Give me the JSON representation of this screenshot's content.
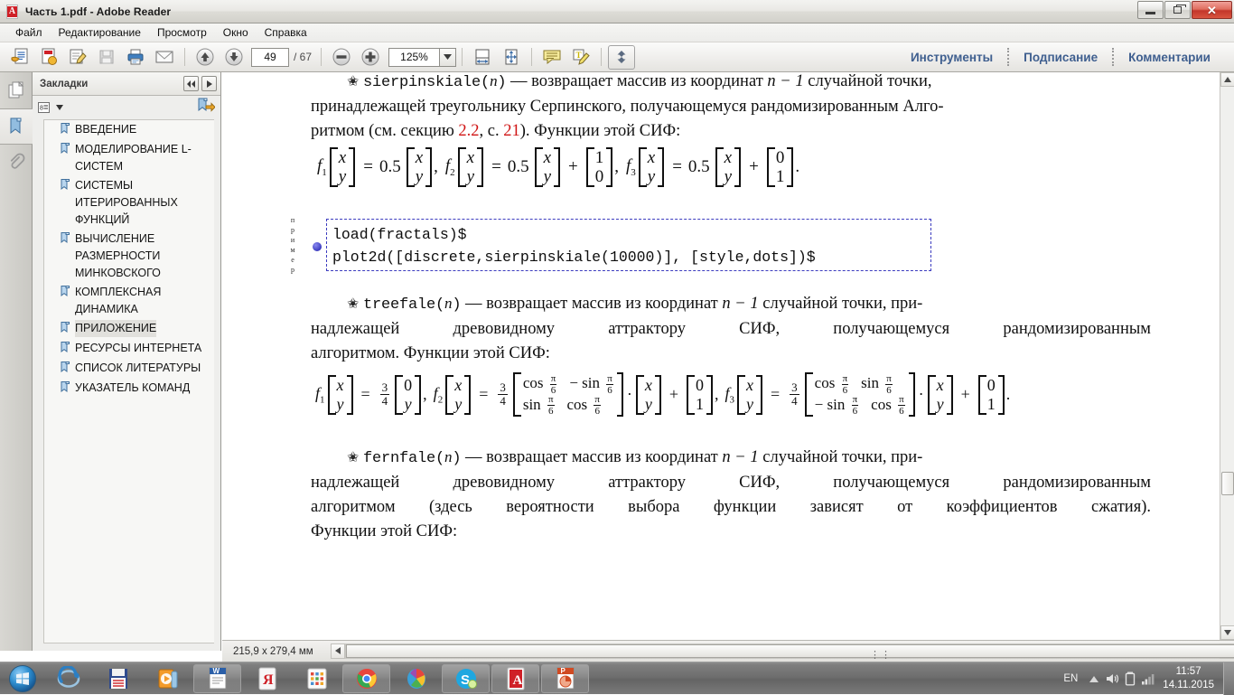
{
  "window": {
    "title": "Часть 1.pdf - Adobe Reader",
    "app_icon": "pdf-icon",
    "controls": {
      "minimize": "minimize-button",
      "restore": "restore-button",
      "close": "close-button"
    }
  },
  "menubar": {
    "items": [
      "Файл",
      "Редактирование",
      "Просмотр",
      "Окно",
      "Справка"
    ]
  },
  "toolbar": {
    "buttons": [
      {
        "name": "open-file-icon"
      },
      {
        "name": "create-pdf-icon"
      },
      {
        "name": "edit-pdf-icon"
      },
      {
        "name": "save-icon"
      },
      {
        "name": "print-icon"
      },
      {
        "name": "email-icon"
      }
    ],
    "nav": {
      "prev_page": "up-arrow-icon",
      "next_page": "down-arrow-icon"
    },
    "page_current": "49",
    "page_total": "/ 67",
    "zoom_out": "zoom-out-icon",
    "zoom_in": "zoom-in-icon",
    "zoom_value": "125%",
    "zoom_dropdown": "chevron-down-icon",
    "view_buttons": [
      {
        "name": "fit-width-icon"
      },
      {
        "name": "fit-page-icon"
      },
      {
        "name": "add-sticky-note-icon"
      },
      {
        "name": "highlight-text-icon"
      },
      {
        "name": "read-mode-icon"
      }
    ],
    "right_links": [
      "Инструменты",
      "Подписание",
      "Комментарии"
    ]
  },
  "rail": {
    "items": [
      {
        "name": "page-thumbnails-icon",
        "active": false
      },
      {
        "name": "bookmarks-icon",
        "active": true
      },
      {
        "name": "attachments-icon",
        "active": false
      }
    ]
  },
  "panel": {
    "title": "Закладки",
    "nav_prev": "double-left-chevron-icon",
    "nav_next": "right-chevron-icon",
    "options_menu": "bookmark-options-icon",
    "new_bookmark": "new-bookmark-icon",
    "bookmarks": [
      {
        "label": "ВВЕДЕНИЕ",
        "selected": false
      },
      {
        "label": "МОДЕЛИРОВАНИЕ L-СИСТЕМ",
        "selected": false
      },
      {
        "label": "СИСТЕМЫ ИТЕРИРОВАННЫХ ФУНКЦИЙ",
        "selected": false
      },
      {
        "label": "ВЫЧИСЛЕНИЕ РАЗМЕРНОСТИ МИНКОВСКОГО",
        "selected": false
      },
      {
        "label": "КОМПЛЕКСНАЯ ДИНАМИКА",
        "selected": false
      },
      {
        "label": "ПРИЛОЖЕНИЕ",
        "selected": true
      },
      {
        "label": "РЕСУРСЫ ИНТЕРНЕТА",
        "selected": false
      },
      {
        "label": "СПИСОК ЛИТЕРАТУРЫ",
        "selected": false
      },
      {
        "label": "УКАЗАТЕЛЬ КОМАНД",
        "selected": false
      }
    ]
  },
  "document": {
    "entry1": {
      "func": "sierpinskiale(",
      "func_arg": "n",
      "func_close": ")",
      "line1_rest": " — возвращает массив из координат ",
      "n_minus_1": "n − 1",
      "line1_tail": " случайной точки,",
      "line2": "принадлежащей треугольнику Серпинского, получающемуся рандомизированным Алго-",
      "line3_a": "ритмом (см. секцию ",
      "line3_ref1": "2.2",
      "line3_b": ", с. ",
      "line3_ref2": "21",
      "line3_c": "). Функции этой СИФ:"
    },
    "formula1": {
      "scalar": "0.5",
      "f1": "f",
      "f1sub": "1",
      "f2": "f",
      "f2sub": "2",
      "f3": "f",
      "f3sub": "3",
      "vx": "x",
      "vy": "y",
      "t2_top": "1",
      "t2_bot": "0",
      "t3_top": "0",
      "t3_bot": "1",
      "eq": "=",
      "plus": "+",
      "comma": ",",
      "period": "."
    },
    "code": {
      "side_label": "пример",
      "lines": [
        "load(fractals)$",
        "plot2d([discrete,sierpinskiale(10000)], [style,dots])$"
      ]
    },
    "entry2": {
      "func": "treefale(",
      "func_arg": "n",
      "func_close": ")",
      "line1_rest": " — возвращает массив из координат ",
      "n_minus_1": "n − 1",
      "line1_tail": " случайной точки, при-",
      "line2": "надлежащей древовидному аттрактору СИФ, получающемуся рандомизированным",
      "line3": "алгоритмом. Функции этой СИФ:"
    },
    "formula2": {
      "scalar_num": "3",
      "scalar_den": "4",
      "f1": "f",
      "f1sub": "1",
      "f2": "f",
      "f2sub": "2",
      "f3": "f",
      "f3sub": "3",
      "vx": "x",
      "vy": "y",
      "zero": "0",
      "m2_a": "cos",
      "m2_b": "− sin",
      "m2_c": "sin",
      "m2_d": "cos",
      "m3_a": "cos",
      "m3_b": "sin",
      "m3_c": "− sin",
      "m3_d": "cos",
      "pi": "π",
      "six": "6",
      "t_top": "0",
      "t_bot": "1",
      "eq": "=",
      "plus": "+",
      "comma": ",",
      "period": ".",
      "dot": "·"
    },
    "entry3": {
      "func": "fernfale(",
      "func_arg": "n",
      "func_close": ")",
      "line1_rest": " — возвращает массив из координат ",
      "n_minus_1": "n − 1",
      "line1_tail": " случайной точки, при-",
      "line2": "надлежащей древовидному аттрактору СИФ, получающемуся рандомизированным",
      "line3": "алгоритмом (здесь вероятности выбора функции зависят от коэффициентов сжатия).",
      "line4": "Функции этой СИФ:"
    }
  },
  "statusbar": {
    "page_size": "215,9 x 279,4 мм",
    "scroll_left": "left-arrow-icon",
    "scroll_right": "right-arrow-icon",
    "grip": "⋮⋮"
  },
  "scrollbar": {
    "up": "scroll-up-arrow-icon",
    "down": "scroll-down-arrow-icon"
  },
  "taskbar": {
    "start": "windows-start-orb",
    "items": [
      {
        "name": "internet-explorer-icon",
        "open": false
      },
      {
        "name": "media-save-icon",
        "open": false
      },
      {
        "name": "media-player-icon",
        "open": false
      },
      {
        "name": "microsoft-word-icon",
        "open": true
      },
      {
        "name": "yandex-browser-icon",
        "open": false
      },
      {
        "name": "app-grid-icon",
        "open": false
      },
      {
        "name": "google-chrome-icon",
        "open": true
      },
      {
        "name": "paint-icon",
        "open": false
      },
      {
        "name": "skype-icon",
        "open": true
      },
      {
        "name": "adobe-reader-icon",
        "open": true
      },
      {
        "name": "powerpoint-icon",
        "open": true
      }
    ],
    "tray": {
      "language": "EN",
      "show_hidden": "up-chevron-icon",
      "volume": "volume-icon",
      "battery": "battery-icon",
      "network": "network-signal-icon",
      "time": "11:57",
      "date": "14.11.2015"
    }
  }
}
